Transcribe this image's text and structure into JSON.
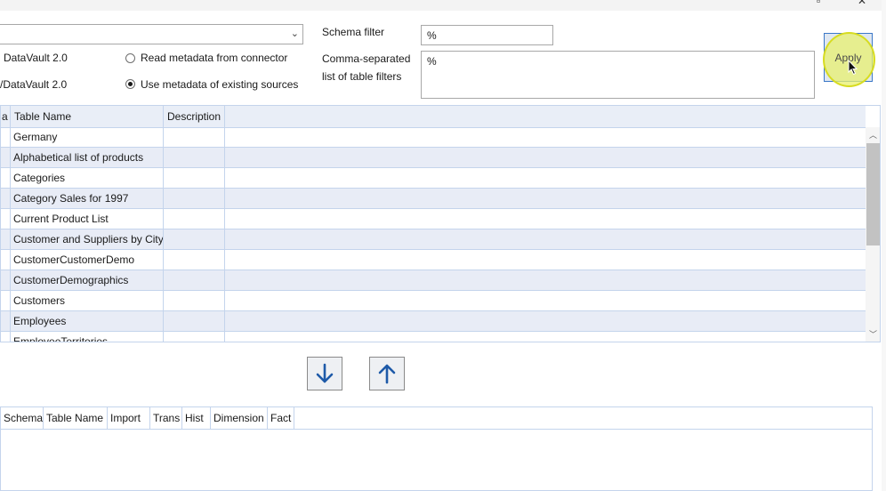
{
  "filters": {
    "schema_filter_label": "Schema filter",
    "schema_filter_value": "%",
    "table_filters_label_line1": "Comma-separated",
    "table_filters_label_line2": "list of table filters",
    "table_filters_value": "%",
    "apply_label": "Apply"
  },
  "options": {
    "left_label_1": "DataVault 2.0",
    "left_label_2": "/DataVault 2.0",
    "radio_connector_label": "Read metadata from connector",
    "radio_existing_label": "Use metadata of existing sources",
    "selected": "existing"
  },
  "source_grid": {
    "columns": [
      "a",
      "Table Name",
      "Description"
    ],
    "rows": [
      "Germany",
      "Alphabetical list of products",
      "Categories",
      "Category Sales for 1997",
      "Current Product List",
      "Customer and Suppliers by City",
      "CustomerCustomerDemo",
      "CustomerDemographics",
      "Customers",
      "Employees",
      "EmployeeTerritories"
    ]
  },
  "move_buttons": {
    "down": "move-down",
    "up": "move-up"
  },
  "target_grid": {
    "columns": [
      "Schema",
      "Table Name",
      "Import",
      "Trans",
      "Hist",
      "Dimension",
      "Fact"
    ]
  },
  "colors": {
    "accent": "#1e5aa8",
    "grid_border": "#c4d4ec",
    "alt_row": "#e8ecf6",
    "highlight": "#e8f06e"
  }
}
